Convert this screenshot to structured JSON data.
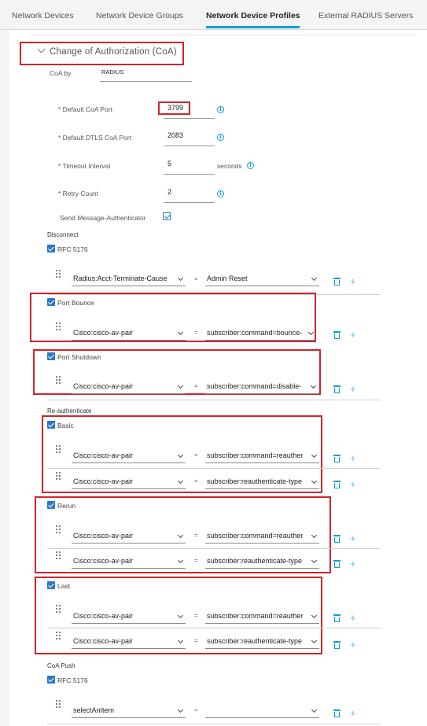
{
  "tabs": [
    {
      "label": "Network Devices",
      "active": false
    },
    {
      "label": "Network Device Groups",
      "active": false
    },
    {
      "label": "Network Device Profiles",
      "active": true
    },
    {
      "label": "External RADIUS Servers",
      "active": false
    }
  ],
  "coa": {
    "section_title": "Change of Authorization (CoA)",
    "coa_by_label": "CoA by",
    "coa_by_value": "RADIUS",
    "default_coa_port_label": "* Default CoA Port",
    "default_coa_port_value": "3799",
    "default_dtls_port_label": "* Default DTLS CoA Port",
    "default_dtls_port_value": "2083",
    "timeout_label": "* Timeout Interval",
    "timeout_value": "5",
    "timeout_unit": "seconds",
    "retry_label": "* Retry Count",
    "retry_value": "2",
    "send_msg_auth_label": "Send Message-Authenticator",
    "send_msg_auth_checked": true
  },
  "disconnect": {
    "heading": "Disconnect",
    "rfc5176": {
      "label": "RFC 5176",
      "checked": true,
      "rows": [
        {
          "attribute": "Radius:Acct-Terminate-Cause",
          "eq": "=",
          "value": "Admin Reset"
        }
      ]
    },
    "port_bounce": {
      "label": "Port Bounce",
      "checked": true,
      "rows": [
        {
          "attribute": "Cisco:cisco-av-pair",
          "eq": "=",
          "value": "subscriber:command=bounce-"
        }
      ]
    },
    "port_shutdown": {
      "label": "Port Shutdown",
      "checked": true,
      "rows": [
        {
          "attribute": "Cisco:cisco-av-pair",
          "eq": "=",
          "value": "subscriber:command=disable-"
        }
      ]
    }
  },
  "reauthenticate": {
    "heading": "Re-authenticate",
    "basic": {
      "label": "Basic",
      "checked": true,
      "rows": [
        {
          "attribute": "Cisco:cisco-av-pair",
          "eq": "=",
          "value": "subscriber:command=reauther"
        },
        {
          "attribute": "Cisco:cisco-av-pair",
          "eq": "=",
          "value": "subscriber:reauthenticate-type"
        }
      ]
    },
    "rerun": {
      "label": "Rerun",
      "checked": true,
      "rows": [
        {
          "attribute": "Cisco:cisco-av-pair",
          "eq": "=",
          "value": "subscriber:command=reauther"
        },
        {
          "attribute": "Cisco:cisco-av-pair",
          "eq": "=",
          "value": "subscriber:reauthenticate-type"
        }
      ]
    },
    "last": {
      "label": "Last",
      "checked": true,
      "rows": [
        {
          "attribute": "Cisco:cisco-av-pair",
          "eq": "=",
          "value": "subscriber:command=reauther"
        },
        {
          "attribute": "Cisco:cisco-av-pair",
          "eq": "=",
          "value": "subscriber:reauthenticate-type"
        }
      ]
    }
  },
  "coa_push": {
    "heading": "CoA Push",
    "rfc5176": {
      "label": "RFC 5176",
      "checked": true,
      "rows": [
        {
          "attribute": "selectAnItem",
          "eq": "=",
          "value": ""
        }
      ]
    }
  },
  "icons": {
    "info": "info-icon",
    "trash": "trash-icon",
    "add": "plus-icon",
    "drag": "drag-handle-icon",
    "dropdown": "chevron-down-icon"
  },
  "colors": {
    "accent": "#049fd9",
    "checkbox": "#2a78c9",
    "highlight_box": "#d2232a"
  }
}
